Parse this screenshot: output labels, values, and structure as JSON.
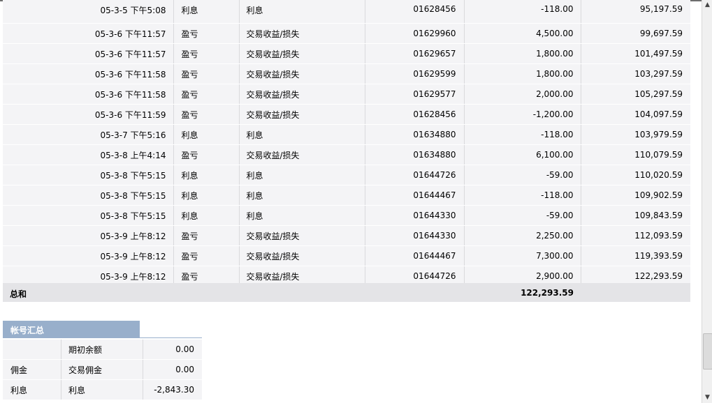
{
  "transactions": [
    {
      "date": "05-3-5 下午5:08",
      "type": "利息",
      "desc": "利息",
      "number": "01628456",
      "amount": "-118.00",
      "balance": "95,197.59"
    },
    {
      "date": "05-3-6 下午11:57",
      "type": "盈亏",
      "desc": "交易收益/损失",
      "number": "01629960",
      "amount": "4,500.00",
      "balance": "99,697.59"
    },
    {
      "date": "05-3-6 下午11:57",
      "type": "盈亏",
      "desc": "交易收益/损失",
      "number": "01629657",
      "amount": "1,800.00",
      "balance": "101,497.59"
    },
    {
      "date": "05-3-6 下午11:58",
      "type": "盈亏",
      "desc": "交易收益/损失",
      "number": "01629599",
      "amount": "1,800.00",
      "balance": "103,297.59"
    },
    {
      "date": "05-3-6 下午11:58",
      "type": "盈亏",
      "desc": "交易收益/损失",
      "number": "01629577",
      "amount": "2,000.00",
      "balance": "105,297.59"
    },
    {
      "date": "05-3-6 下午11:59",
      "type": "盈亏",
      "desc": "交易收益/损失",
      "number": "01628456",
      "amount": "-1,200.00",
      "balance": "104,097.59"
    },
    {
      "date": "05-3-7 下午5:16",
      "type": "利息",
      "desc": "利息",
      "number": "01634880",
      "amount": "-118.00",
      "balance": "103,979.59"
    },
    {
      "date": "05-3-8 上午4:14",
      "type": "盈亏",
      "desc": "交易收益/损失",
      "number": "01634880",
      "amount": "6,100.00",
      "balance": "110,079.59"
    },
    {
      "date": "05-3-8 下午5:15",
      "type": "利息",
      "desc": "利息",
      "number": "01644726",
      "amount": "-59.00",
      "balance": "110,020.59"
    },
    {
      "date": "05-3-8 下午5:15",
      "type": "利息",
      "desc": "利息",
      "number": "01644467",
      "amount": "-118.00",
      "balance": "109,902.59"
    },
    {
      "date": "05-3-8 下午5:15",
      "type": "利息",
      "desc": "利息",
      "number": "01644330",
      "amount": "-59.00",
      "balance": "109,843.59"
    },
    {
      "date": "05-3-9 上午8:12",
      "type": "盈亏",
      "desc": "交易收益/损失",
      "number": "01644330",
      "amount": "2,250.00",
      "balance": "112,093.59"
    },
    {
      "date": "05-3-9 上午8:12",
      "type": "盈亏",
      "desc": "交易收益/损失",
      "number": "01644467",
      "amount": "7,300.00",
      "balance": "119,393.59"
    },
    {
      "date": "05-3-9 上午8:12",
      "type": "盈亏",
      "desc": "交易收益/损失",
      "number": "01644726",
      "amount": "2,900.00",
      "balance": "122,293.59"
    }
  ],
  "total": {
    "label": "总和",
    "value": "122,293.59"
  },
  "summary": {
    "title": "帐号汇总",
    "rows": [
      {
        "category": "",
        "item": "期初余额",
        "value": "0.00"
      },
      {
        "category": "佣金",
        "item": "交易佣金",
        "value": "0.00"
      },
      {
        "category": "利息",
        "item": "利息",
        "value": "-2,843.30"
      }
    ]
  },
  "scrollbar": {
    "up_icon": "▲",
    "down_icon": "▼"
  }
}
